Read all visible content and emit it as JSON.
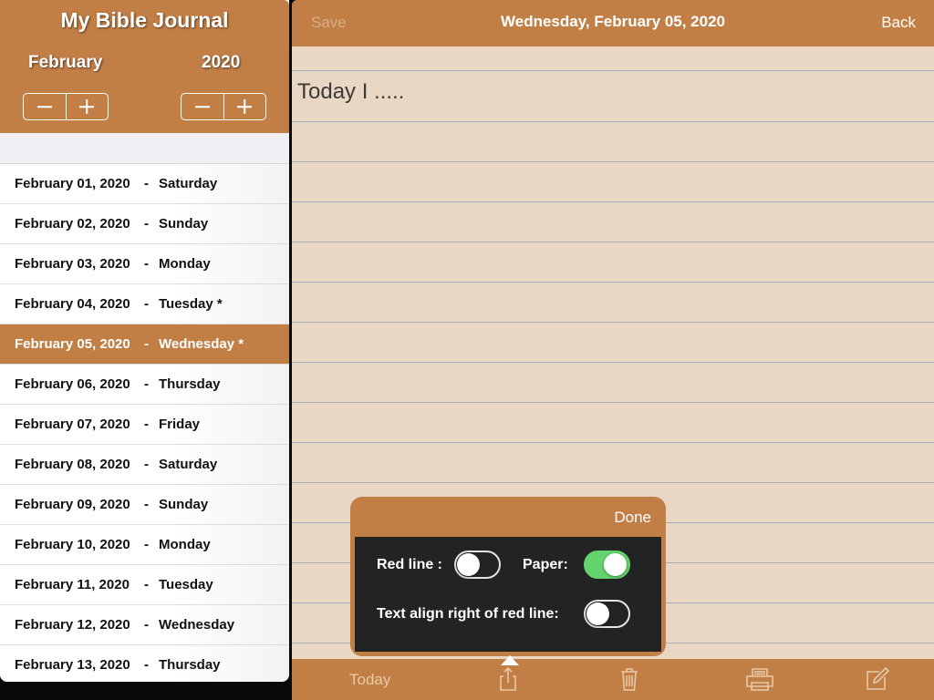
{
  "sidebar": {
    "title": "My Bible Journal",
    "month": "February",
    "year": "2020",
    "days": [
      {
        "date": "February 01, 2020",
        "sep": "-",
        "weekday": "Saturday"
      },
      {
        "date": "February 02, 2020",
        "sep": "-",
        "weekday": "Sunday"
      },
      {
        "date": "February 03, 2020",
        "sep": "-",
        "weekday": "Monday"
      },
      {
        "date": "February 04, 2020",
        "sep": "-",
        "weekday": "Tuesday *"
      },
      {
        "date": "February 05, 2020",
        "sep": "-",
        "weekday": "Wednesday *"
      },
      {
        "date": "February 06, 2020",
        "sep": "-",
        "weekday": "Thursday"
      },
      {
        "date": "February 07, 2020",
        "sep": "-",
        "weekday": "Friday"
      },
      {
        "date": "February 08, 2020",
        "sep": "-",
        "weekday": "Saturday"
      },
      {
        "date": "February 09, 2020",
        "sep": "-",
        "weekday": "Sunday"
      },
      {
        "date": "February 10, 2020",
        "sep": "-",
        "weekday": "Monday"
      },
      {
        "date": "February 11, 2020",
        "sep": "-",
        "weekday": "Tuesday"
      },
      {
        "date": "February 12, 2020",
        "sep": "-",
        "weekday": "Wednesday"
      },
      {
        "date": "February 13, 2020",
        "sep": "-",
        "weekday": "Thursday"
      }
    ],
    "selected_index": 4
  },
  "topbar": {
    "save_label": "Save",
    "title": "Wednesday, February 05, 2020",
    "back_label": "Back"
  },
  "editor": {
    "text": "Today I ....."
  },
  "popover": {
    "done_label": "Done",
    "red_line_label": "Red line :",
    "red_line_on": false,
    "paper_label": "Paper:",
    "paper_on": true,
    "align_label": "Text align right of red line:",
    "align_on": false
  },
  "bottombar": {
    "today_label": "Today",
    "icons": [
      "share-icon",
      "trash-icon",
      "print-icon",
      "compose-icon"
    ]
  },
  "colors": {
    "accent": "#c17f46",
    "paper": "#ead7c3",
    "toggle_on": "#65d36e",
    "popover_panel": "#222324"
  }
}
